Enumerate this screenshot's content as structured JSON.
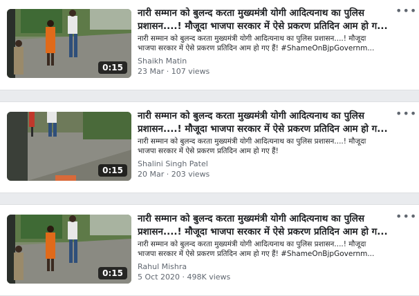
{
  "videos": [
    {
      "title_line1": "नारी सम्मान को बुलन्द करता मुख्यमंत्री योगी आदित्यनाथ का पुलिस",
      "title_line2": "प्रशासन....! मौजूदा भाजपा सरकार में ऐसे प्रकरण प्रतिदिन आम हो ग...",
      "desc_line1": "नारी सम्मान को बुलन्द करता मुख्यमंत्री योगी आदित्यनाथ का पुलिस प्रशासन....! मौजूदा",
      "desc_line2": "भाजपा सरकार में ऐसे प्रकरण प्रतिदिन आम हो गए हैं! #ShameOnBjpGovernm...",
      "author": "Shaikh Matin",
      "meta": "23 Mar · 107 views",
      "duration": "0:15",
      "more_icon": "ellipsis-icon"
    },
    {
      "title_line1": "नारी सम्मान को बुलन्द करता मुख्यमंत्री योगी आदित्यनाथ का पुलिस",
      "title_line2": "प्रशासन....! मौजूदा भाजपा सरकार में ऐसे प्रकरण प्रतिदिन आम हो ग...",
      "desc_line1": "नारी सम्मान को बुलन्द करता मुख्यमंत्री योगी आदित्यनाथ का पुलिस प्रशासन....! मौजूदा",
      "desc_line2": "भाजपा सरकार में ऐसे प्रकरण प्रतिदिन आम हो गए हैं!",
      "author": "Shalini Singh Patel",
      "meta": "20 Mar · 203 views",
      "duration": "0:15",
      "more_icon": "ellipsis-icon"
    },
    {
      "title_line1": "नारी सम्मान को बुलन्द करता मुख्यमंत्री योगी आदित्यनाथ का पुलिस",
      "title_line2": "प्रशासन....! मौजूदा भाजपा सरकार में ऐसे प्रकरण प्रतिदिन आम हो ग...",
      "desc_line1": "नारी सम्मान को बुलन्द करता मुख्यमंत्री योगी आदित्यनाथ का पुलिस प्रशासन....! मौजूदा",
      "desc_line2": "भाजपा सरकार में ऐसे प्रकरण प्रतिदिन आम हो गए हैं! #ShameOnBjpGovernm...",
      "author": "Rahul Mishra",
      "meta": "5 Oct 2020 · 498K views",
      "duration": "0:15",
      "more_icon": "ellipsis-icon"
    }
  ],
  "colors": {
    "page_bg": "#e9ebee",
    "card_bg": "#ffffff",
    "text_primary": "#1c1e21",
    "text_secondary": "#606770"
  }
}
